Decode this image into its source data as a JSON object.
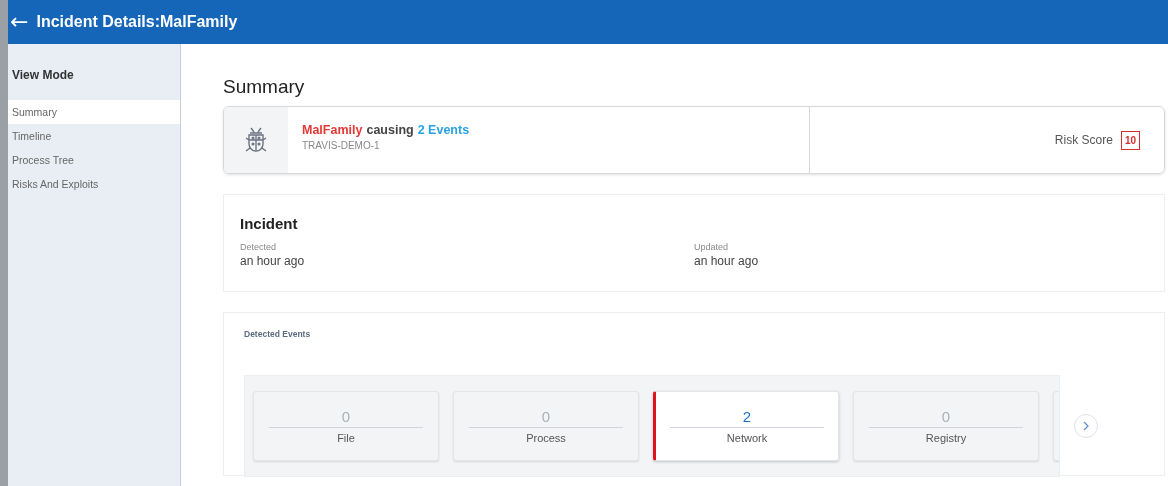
{
  "header": {
    "back_icon": "←",
    "title": "Incident Details:MalFamily"
  },
  "sidebar": {
    "heading": "View Mode",
    "items": [
      {
        "label": "Summary",
        "selected": true
      },
      {
        "label": "Timeline",
        "selected": false
      },
      {
        "label": "Process Tree",
        "selected": false
      },
      {
        "label": "Risks And Exploits",
        "selected": false
      }
    ]
  },
  "page_title": "Summary",
  "summary_card": {
    "family": "MalFamily",
    "causing": "causing",
    "events": "2 Events",
    "host": "TRAVIS-DEMO-1",
    "risk_label": "Risk Score",
    "risk_score": "10"
  },
  "incident": {
    "title": "Incident",
    "fields": [
      {
        "label": "Detected",
        "value": "an hour ago"
      },
      {
        "label": "Updated",
        "value": "an hour ago"
      }
    ]
  },
  "detected_events": {
    "title": "Detected Events",
    "items": [
      {
        "count": "0",
        "label": "File",
        "selected": false
      },
      {
        "count": "0",
        "label": "Process",
        "selected": false
      },
      {
        "count": "2",
        "label": "Network",
        "selected": true
      },
      {
        "count": "0",
        "label": "Registry",
        "selected": false
      }
    ]
  }
}
